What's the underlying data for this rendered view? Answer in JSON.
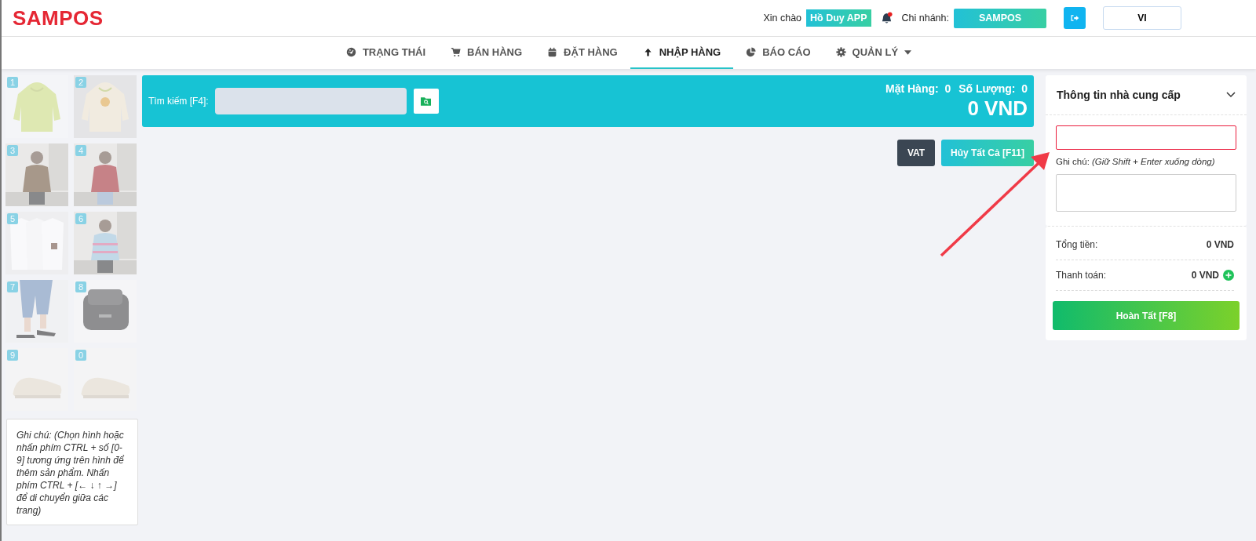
{
  "header": {
    "logo": "SAMPOS",
    "greeting": "Xin chào",
    "user": "Hồ Duy APP",
    "branch_label": "Chi nhánh:",
    "branch": "SAMPOS",
    "language": "VI",
    "notification": true
  },
  "nav": [
    {
      "label": "TRẠNG THÁI",
      "selected": false,
      "dropdown": false
    },
    {
      "label": "BÁN HÀNG",
      "selected": false,
      "dropdown": false
    },
    {
      "label": "ĐẶT HÀNG",
      "selected": false,
      "dropdown": false
    },
    {
      "label": "NHẬP HÀNG",
      "selected": true,
      "dropdown": false
    },
    {
      "label": "BÁO CÁO",
      "selected": false,
      "dropdown": false
    },
    {
      "label": "QUẢN LÝ",
      "selected": false,
      "dropdown": true
    }
  ],
  "products": [
    {
      "key": "1",
      "kind": "picture"
    },
    {
      "key": "2",
      "kind": "picture"
    },
    {
      "key": "3",
      "kind": "picture"
    },
    {
      "key": "4",
      "kind": "picture"
    },
    {
      "key": "5",
      "kind": "picture"
    },
    {
      "key": "6",
      "kind": "picture"
    },
    {
      "key": "7",
      "kind": "picture"
    },
    {
      "key": "8",
      "kind": "picture"
    },
    {
      "key": "9",
      "kind": "picture"
    },
    {
      "key": "0",
      "kind": "picture"
    }
  ],
  "product_note": "Ghi chú: (Chọn hình hoặc nhấn phím CTRL + số [0-9] tương ứng trên hình để thêm sản phẩm. Nhấn phím CTRL + [← ↓ ↑ →] để di chuyển giữa các trang)",
  "search": {
    "label": "Tìm kiếm [F4]:"
  },
  "summary": {
    "items_label": "Mặt Hàng:",
    "items": "0",
    "qty_label": "Số Lượng:",
    "qty": "0",
    "total": "0 VND"
  },
  "actions": [
    "VAT",
    "Hủy Tất Cả [F11]"
  ],
  "supplier": {
    "title": "Thông tin nhà cung cấp",
    "expanded": true,
    "invalid": true,
    "note_label": "Ghi chú: *(Giữ Shift + Enter xuống dòng)*",
    "rows": [
      {
        "label": "Tổng tiền:",
        "value": "0 VND",
        "add": false
      },
      {
        "label": "Thanh toán:",
        "value": "0 VND",
        "add": true
      }
    ],
    "submit": "Hoàn Tất [F8]"
  }
}
